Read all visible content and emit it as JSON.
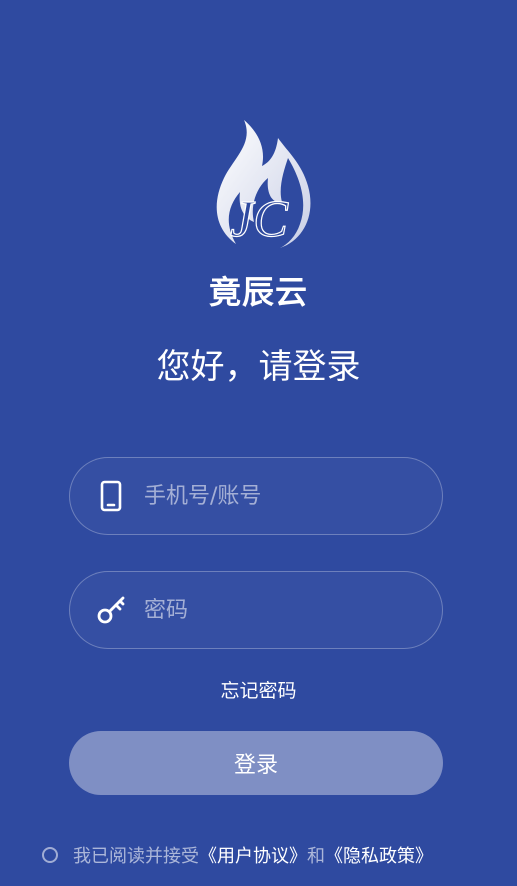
{
  "brand": {
    "name": "竟辰云",
    "logo_letters": "JC",
    "logo_icon": "flame-logo-icon"
  },
  "greeting": "您好，请登录",
  "phone_field": {
    "placeholder": "手机号/账号",
    "value": "",
    "icon": "phone-icon"
  },
  "password_field": {
    "placeholder": "密码",
    "value": "",
    "icon": "key-icon"
  },
  "forgot_password_label": "忘记密码",
  "login_button_label": "登录",
  "agreement": {
    "prefix": "我已阅读并接受",
    "user_agreement": "《用户协议》",
    "conjunction": "和",
    "privacy_policy": "《隐私政策》",
    "checked": false
  },
  "colors": {
    "background": "#2f4aa0",
    "button": "#7f8fc4",
    "text": "#ffffff"
  }
}
